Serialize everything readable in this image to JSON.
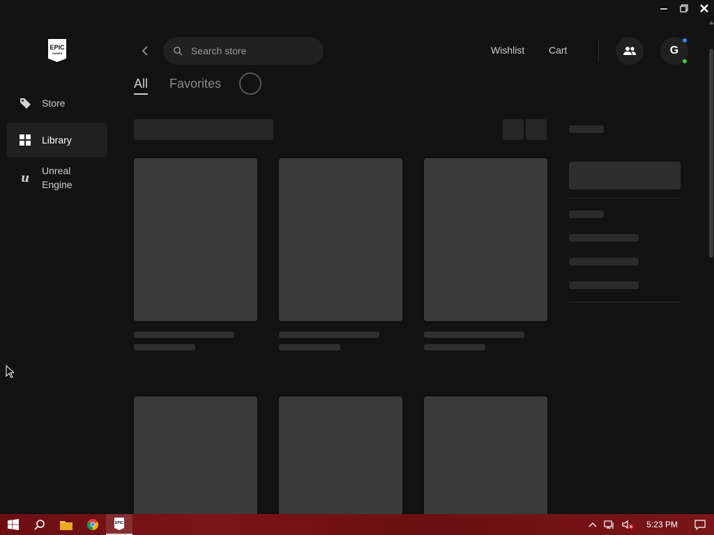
{
  "sidebar": {
    "logo_alt": "EPIC GAMES",
    "items": [
      {
        "label": "Store",
        "icon": "tag-icon"
      },
      {
        "label": "Library",
        "icon": "grid-icon",
        "active": true
      },
      {
        "label": "Unreal Engine",
        "icon": "unreal-icon"
      }
    ]
  },
  "header": {
    "search_placeholder": "Search store",
    "wishlist_label": "Wishlist",
    "cart_label": "Cart",
    "avatar_initial": "G"
  },
  "tabs": [
    {
      "label": "All",
      "active": true
    },
    {
      "label": "Favorites"
    }
  ],
  "taskbar": {
    "clock": "5:23 PM"
  },
  "colors": {
    "background": "#121212",
    "panel": "#202020",
    "skeleton": "#3a3a3a",
    "status_online": "#3ccf4e",
    "notification": "#2a8cff"
  }
}
